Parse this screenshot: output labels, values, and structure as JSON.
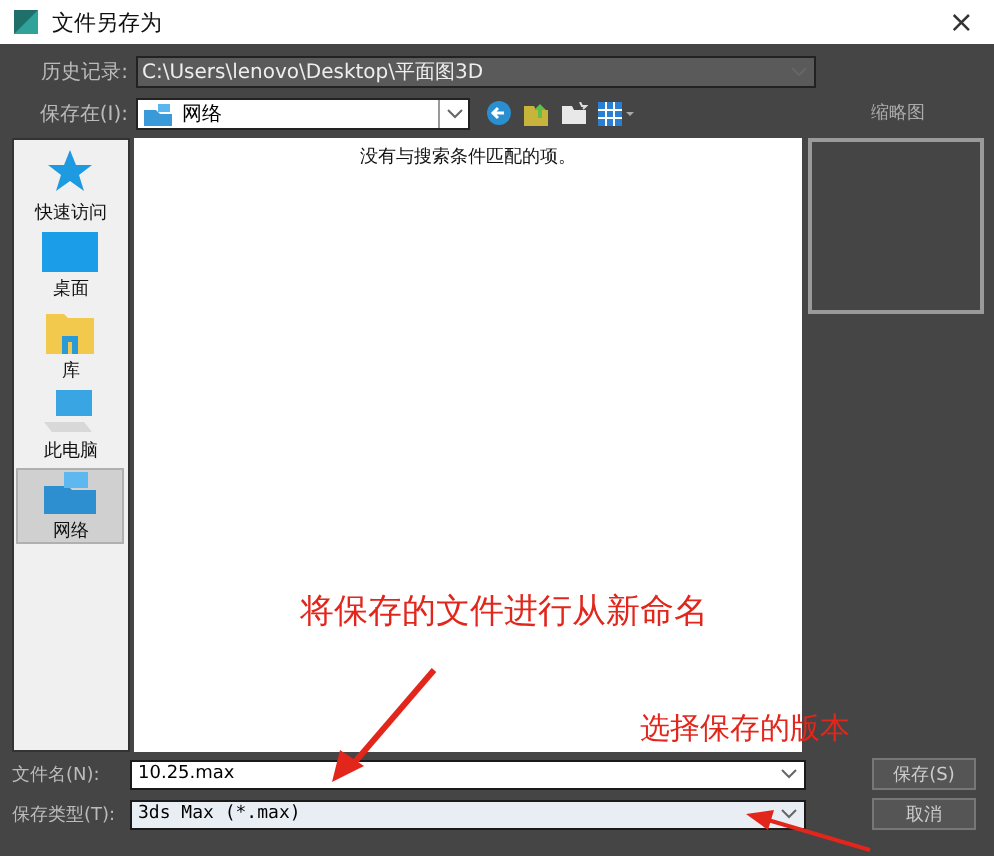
{
  "window": {
    "title": "文件另存为",
    "close": "×"
  },
  "history": {
    "label": "历史记录:",
    "value": "C:\\Users\\lenovo\\Desktop\\平面图3D"
  },
  "save_in": {
    "label": "保存在(I):",
    "value": "网络"
  },
  "thumbnail": {
    "label": "缩略图"
  },
  "sidebar": {
    "items": [
      {
        "label": "快速访问",
        "kind": "star",
        "selected": false
      },
      {
        "label": "桌面",
        "kind": "desktop",
        "selected": false
      },
      {
        "label": "库",
        "kind": "library",
        "selected": false
      },
      {
        "label": "此电脑",
        "kind": "computer",
        "selected": false
      },
      {
        "label": "网络",
        "kind": "network",
        "selected": true
      }
    ]
  },
  "file_list": {
    "message": "没有与搜索条件匹配的项。"
  },
  "file_name": {
    "label": "文件名(N):",
    "value": "10.25.max"
  },
  "file_type": {
    "label": "保存类型(T):",
    "value": "3ds Max (*.max)"
  },
  "buttons": [
    "保存(S)",
    "取消"
  ],
  "annotations": [
    {
      "text": "将保存的文件进行从新命名",
      "kind": "rename"
    },
    {
      "text": "选择保存的版本",
      "kind": "version"
    }
  ]
}
